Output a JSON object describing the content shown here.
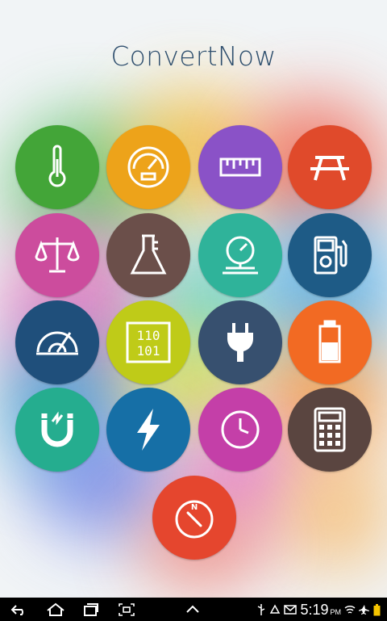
{
  "app": {
    "title": "ConvertNow"
  },
  "tiles": [
    {
      "name": "temperature",
      "color": "#43a538",
      "icon": "thermometer-icon"
    },
    {
      "name": "speed",
      "color": "#eda31a",
      "icon": "speedometer-icon"
    },
    {
      "name": "length",
      "color": "#8a52c7",
      "icon": "ruler-icon"
    },
    {
      "name": "area",
      "color": "#e04a2b",
      "icon": "picnic-table-icon"
    },
    {
      "name": "weight",
      "color": "#cc4c9d",
      "icon": "scales-icon"
    },
    {
      "name": "volume",
      "color": "#6b4f4a",
      "icon": "beaker-icon"
    },
    {
      "name": "pressure",
      "color": "#2fb39a",
      "icon": "pressure-gauge-icon"
    },
    {
      "name": "fuel-consumption",
      "color": "#1e5b86",
      "icon": "fuel-pump-icon"
    },
    {
      "name": "angle",
      "color": "#1f4f7b",
      "icon": "protractor-icon"
    },
    {
      "name": "digital-storage",
      "color": "#bfcb18",
      "icon": "binary-icon",
      "lines": [
        "110",
        "101"
      ]
    },
    {
      "name": "power",
      "color": "#37506f",
      "icon": "plug-icon"
    },
    {
      "name": "energy",
      "color": "#f26a23",
      "icon": "battery-icon"
    },
    {
      "name": "magnetism",
      "color": "#25ad8f",
      "icon": "magnet-icon"
    },
    {
      "name": "electricity",
      "color": "#166fa6",
      "icon": "lightning-icon"
    },
    {
      "name": "time",
      "color": "#c43fa8",
      "icon": "clock-icon"
    },
    {
      "name": "calculator",
      "color": "#5a4540",
      "icon": "calculator-icon"
    },
    {
      "name": "direction",
      "color": "#e5462e",
      "icon": "compass-icon",
      "letter": "N"
    }
  ],
  "status_bar": {
    "time": "5:19",
    "ampm": "PM"
  }
}
